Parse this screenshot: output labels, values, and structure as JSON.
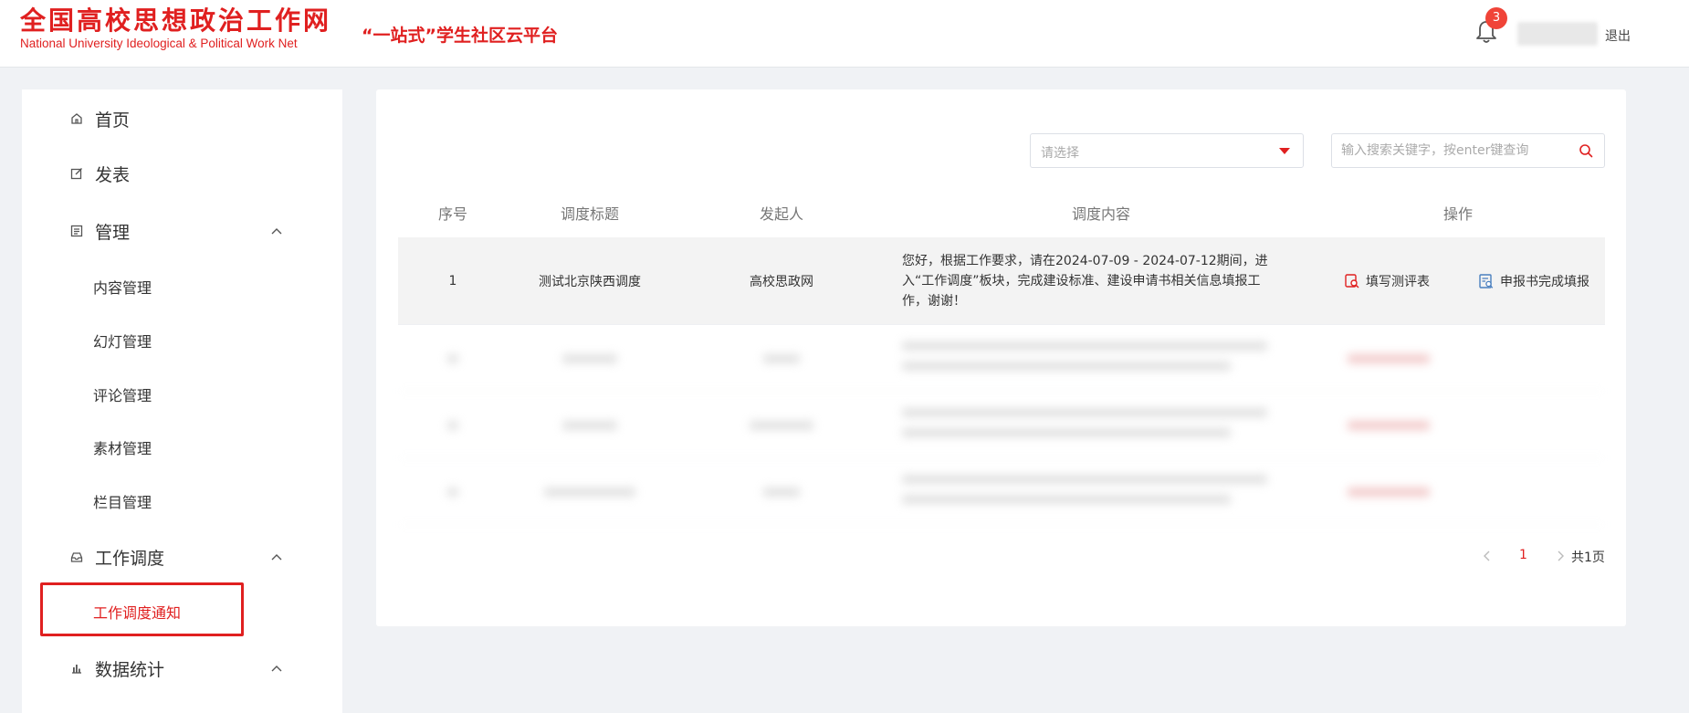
{
  "header": {
    "logo_cn": "全国高校思想政治工作网",
    "logo_en": "National University Ideological & Political Work Net",
    "platform_title": "“一站式”学生社区云平台",
    "notification_count": "3",
    "logout_label": "退出",
    "brand_color": "#e02020"
  },
  "sidebar": {
    "home": "首页",
    "publish": "发表",
    "manage": "管理",
    "manage_items": [
      "内容管理",
      "幻灯管理",
      "评论管理",
      "素材管理",
      "栏目管理"
    ],
    "work_dispatch": "工作调度",
    "work_dispatch_items": [
      "工作调度通知"
    ],
    "data_stats": "数据统计"
  },
  "filters": {
    "select_placeholder": "请选择",
    "search_placeholder": "输入搜索关键字，按enter键查询"
  },
  "table": {
    "columns": [
      "序号",
      "调度标题",
      "发起人",
      "调度内容",
      "操作"
    ],
    "rows": [
      {
        "index": "1",
        "title": "测试北京陕西调度",
        "initiator": "高校思政网",
        "content": "您好，根据工作要求，请在2024-07-09 - 2024-07-12期间，进入“工作调度”板块，完成建设标准、建设申请书相关信息填报工作，谢谢！",
        "action_fill": "填写测评表",
        "action_report": "申报书完成填报"
      }
    ]
  },
  "pagination": {
    "current_page": "1",
    "total_label": "共1页"
  }
}
